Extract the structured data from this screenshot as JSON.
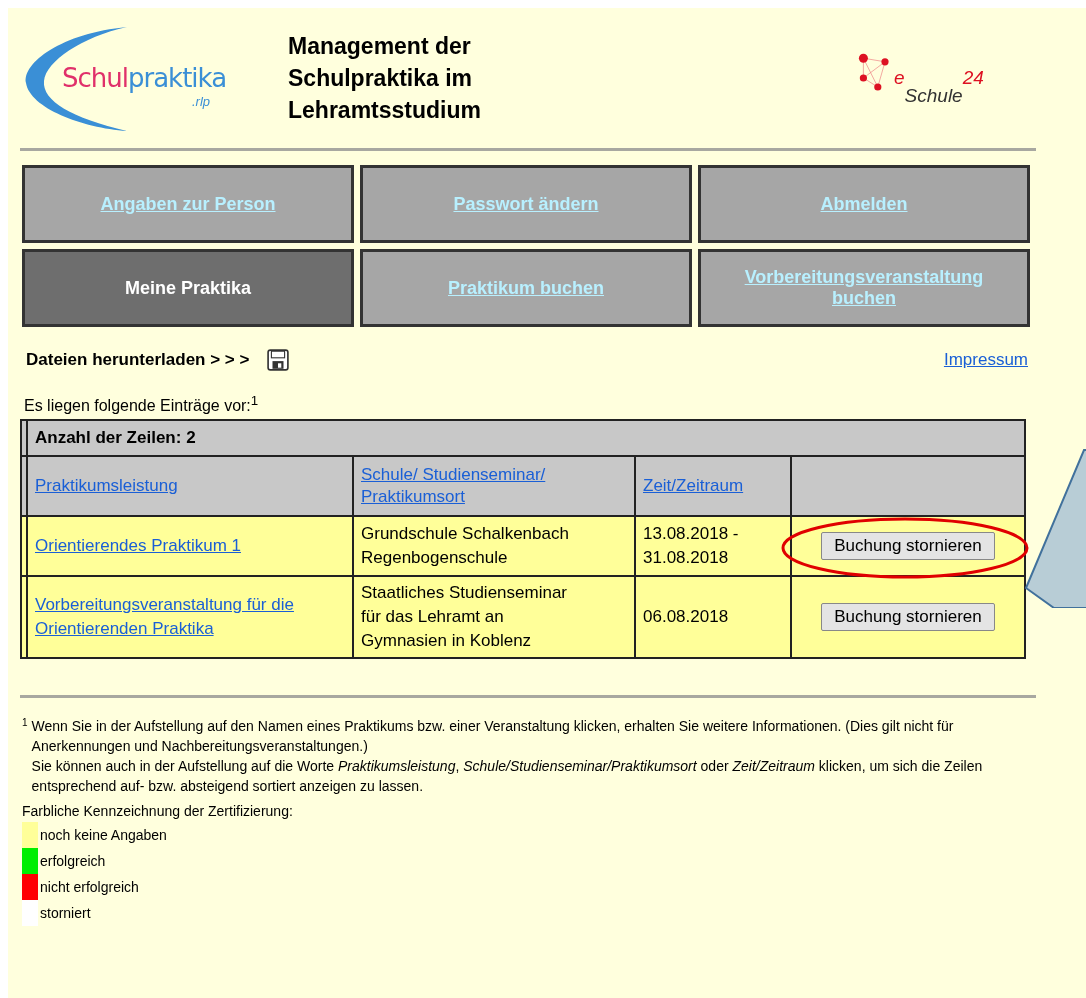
{
  "header": {
    "logo_left": {
      "part_1": "Schul",
      "part_2": "praktika",
      "suffix": ".rlp"
    },
    "title": "Management der Schulpraktika im Lehramtsstudium",
    "logo_right": {
      "part_1": "e",
      "part_2": "Schule",
      "part_3": "24"
    }
  },
  "nav": [
    {
      "label": "Angaben zur Person",
      "selected": false
    },
    {
      "label": "Passwort ändern",
      "selected": false
    },
    {
      "label": "Abmelden",
      "selected": false
    },
    {
      "label": "Meine Praktika",
      "selected": true
    },
    {
      "label": "Praktikum buchen",
      "selected": false
    },
    {
      "label": "Vorbereitungsveranstaltung buchen",
      "selected": false
    }
  ],
  "downloads": {
    "label": "Dateien herunterladen > > >"
  },
  "impressum": "Impressum",
  "intro": "Es liegen folgende Einträge vor:$^{1}$",
  "table": {
    "row_count": "Anzahl der Zeilen: 2",
    "columns": [
      "Praktikumsleistung",
      "Schule/ Studienseminar/ Praktikumsort",
      "Zeit/Zeitraum"
    ],
    "rows": [
      {
        "color": "#ffff99",
        "name": "Orientierendes Praktikum 1",
        "place": [
          "Grundschule Schalkenbach",
          "Regenbogenschule"
        ],
        "time": [
          "13.08.2018 -",
          "31.08.2018"
        ],
        "action": "Buchung stornieren"
      },
      {
        "color": "#ffff99",
        "name": "Vorbereitungsveranstaltung für die Orientierenden Praktika",
        "place": [
          "Staatliches Studienseminar",
          "für das Lehramt an",
          "Gymnasien in Koblenz"
        ],
        "time": [
          "06.08.2018"
        ],
        "action": "Buchung stornieren"
      }
    ]
  },
  "footnote": {
    "mark": "1",
    "lines": [
      "Wenn Sie in der Aufstellung auf den Namen eines Praktikums bzw. einer Veranstaltung klicken, erhalten Sie weitere Informationen. (Dies gilt nicht für Anerkennungen und Nachbereitungsveranstaltungen.)",
      "Sie können auch in der Aufstellung auf die Worte *Praktikumsleistung*, *Schule/Studienseminar/Praktikumsort* oder *Zeit/Zeitraum* klicken, um sich die Zeilen entsprechend auf- bzw. absteigend sortiert anzeigen zu lassen."
    ]
  },
  "legend": {
    "title": "Farbliche Kennzeichnung der Zertifizierung:",
    "items": [
      {
        "color": "#ffff99",
        "label": "noch keine Angaben"
      },
      {
        "color": "#00ee00",
        "label": "erfolgreich"
      },
      {
        "color": "#ff0000",
        "label": "nicht erfolgreich"
      },
      {
        "color": "#ffffff",
        "label": "storniert"
      }
    ]
  }
}
